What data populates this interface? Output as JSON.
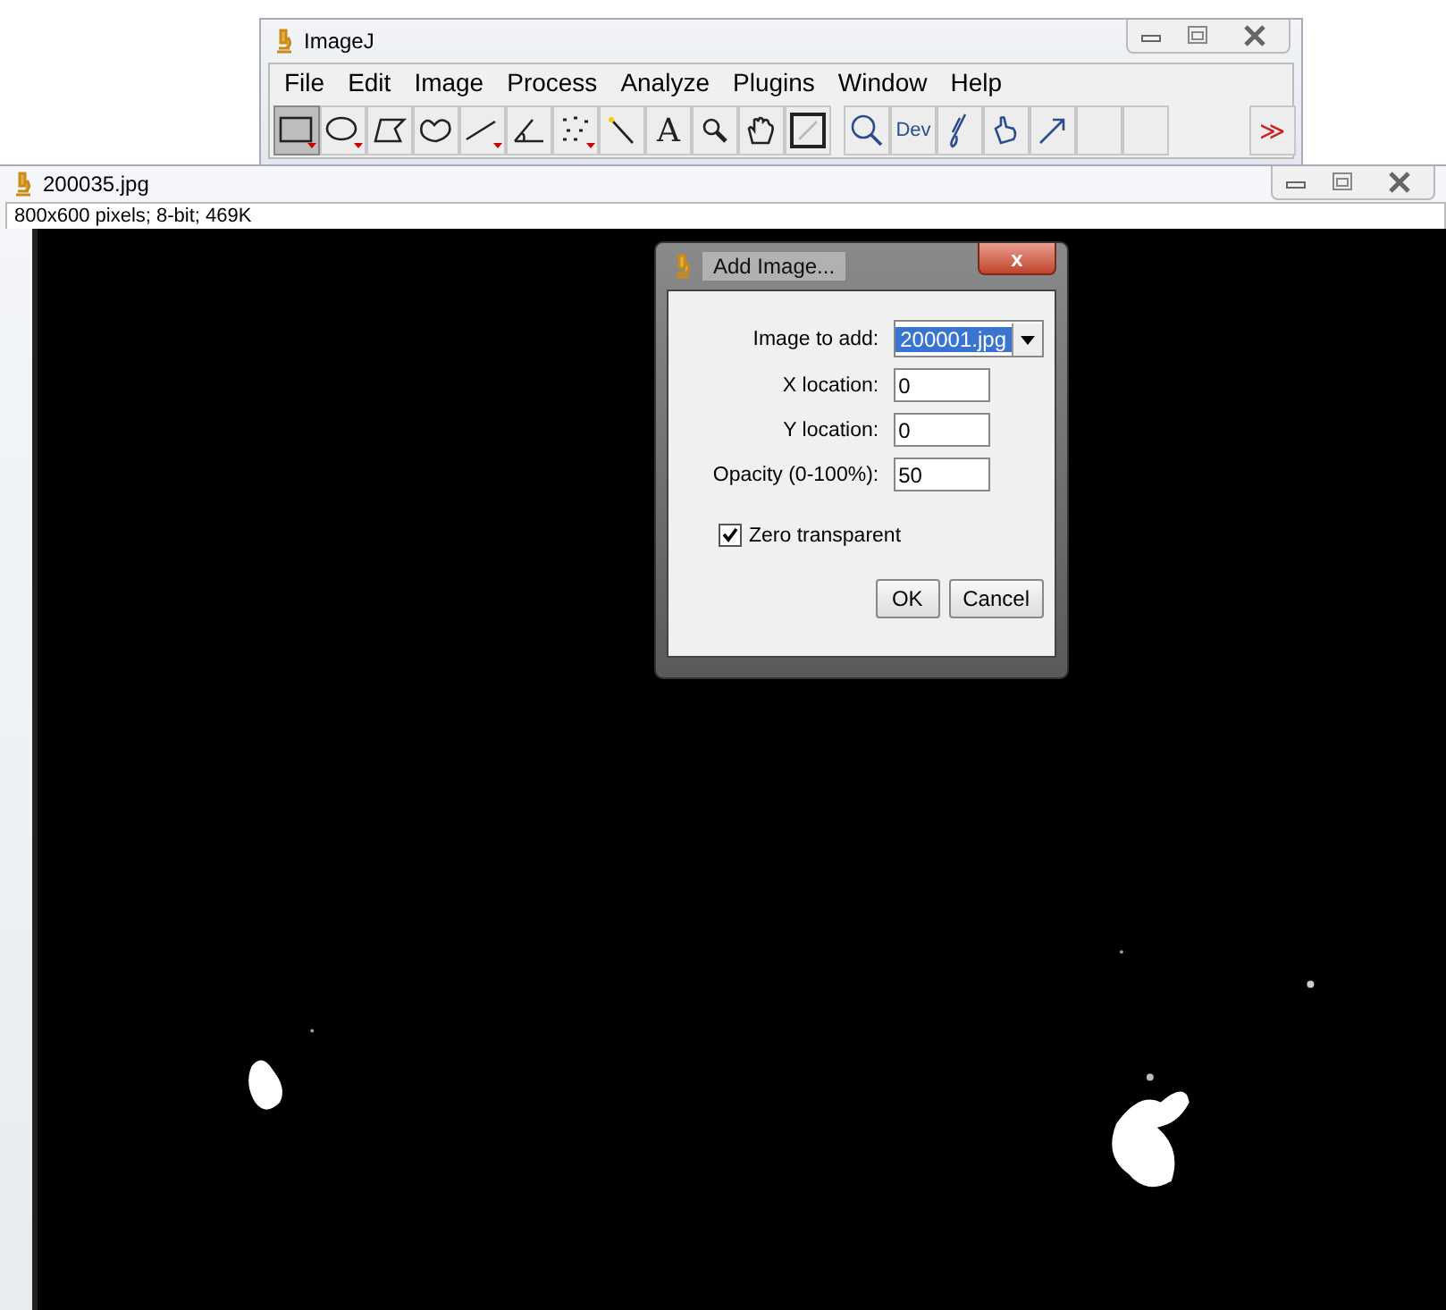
{
  "main_window": {
    "title": "ImageJ",
    "menu": [
      "File",
      "Edit",
      "Image",
      "Process",
      "Analyze",
      "Plugins",
      "Window",
      "Help"
    ],
    "tools": [
      {
        "kind": "rect",
        "selected": true
      },
      {
        "kind": "oval",
        "selected": false
      },
      {
        "kind": "polygon",
        "selected": false
      },
      {
        "kind": "freehand",
        "selected": false
      },
      {
        "kind": "line",
        "selected": false
      },
      {
        "kind": "angle",
        "selected": false
      },
      {
        "kind": "points",
        "selected": false
      },
      {
        "kind": "wand",
        "selected": false
      },
      {
        "kind": "text",
        "label": "A",
        "selected": false
      },
      {
        "kind": "magnifier",
        "selected": false
      },
      {
        "kind": "hand",
        "selected": false
      },
      {
        "kind": "picker",
        "selected": false
      },
      {
        "kind": "search",
        "selected": false
      },
      {
        "kind": "text",
        "label": "Dev",
        "selected": false
      },
      {
        "kind": "brush",
        "selected": false
      },
      {
        "kind": "pointer",
        "selected": false
      },
      {
        "kind": "arrow",
        "selected": false
      },
      {
        "kind": "blank",
        "selected": false
      },
      {
        "kind": "blank",
        "selected": false
      },
      {
        "kind": "more",
        "label": "≫",
        "selected": false
      }
    ]
  },
  "image_window": {
    "title": "200035.jpg",
    "info": "800x600 pixels; 8-bit; 469K"
  },
  "dialog": {
    "title": "Add Image...",
    "close": "x",
    "fields": [
      {
        "kind": "dropdown",
        "label": "Image to add:",
        "value": "200001.jpg"
      },
      {
        "kind": "text",
        "label": "X location:",
        "value": "0"
      },
      {
        "kind": "text",
        "label": "Y location:",
        "value": "0"
      },
      {
        "kind": "text",
        "label": "Opacity (0-100%):",
        "value": "50"
      }
    ],
    "checkbox": {
      "label": "Zero transparent",
      "checked": true
    },
    "buttons": [
      "OK",
      "Cancel"
    ]
  }
}
